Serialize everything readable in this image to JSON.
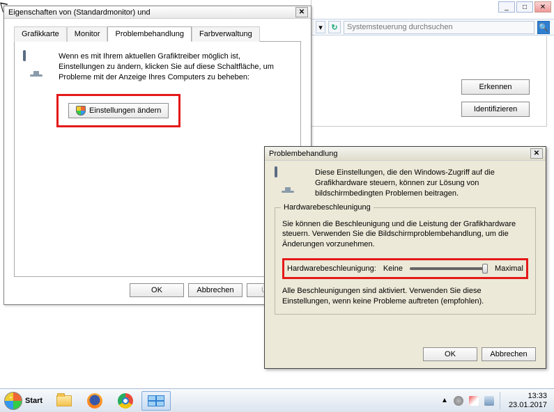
{
  "dlg1": {
    "title": "Eigenschaften von (Standardmonitor) und",
    "tabs": [
      "Grafikkarte",
      "Monitor",
      "Problembehandlung",
      "Farbverwaltung"
    ],
    "active_tab_index": 2,
    "intro": "Wenn es mit Ihrem aktuellen Grafiktreiber möglich ist, Einstellungen zu ändern, klicken Sie auf diese Schaltfläche, um Probleme mit der Anzeige Ihres Computers zu beheben:",
    "change_btn": "Einstellungen ändern",
    "ok": "OK",
    "cancel": "Abbrechen",
    "apply": "Überne"
  },
  "parent": {
    "search_placeholder": "Systemsteuerung durchsuchen",
    "btn_detect": "Erkennen",
    "btn_identify": "Identifizieren"
  },
  "dlg2": {
    "title": "Problembehandlung",
    "intro": "Diese Einstellungen, die den Windows-Zugriff auf die Grafikhardware steuern, können zur Lösung von bildschirmbedingten Problemen beitragen.",
    "group_legend": "Hardwarebeschleunigung",
    "group_text": "Sie können die Beschleunigung und die Leistung der Grafikhardware steuern. Verwenden Sie die Bildschirmproblembehandlung, um die Änderungen vorzunehmen.",
    "slider_label": "Hardwarebeschleunigung:",
    "slider_min": "Keine",
    "slider_max": "Maximal",
    "slider_value": 5,
    "slider_range": [
      0,
      5
    ],
    "note": "Alle Beschleunigungen sind aktiviert. Verwenden Sie diese Einstellungen, wenn keine Probleme auftreten (empfohlen).",
    "ok": "OK",
    "cancel": "Abbrechen"
  },
  "taskbar": {
    "start": "Start",
    "time": "13:33",
    "date": "23.01.2017"
  }
}
